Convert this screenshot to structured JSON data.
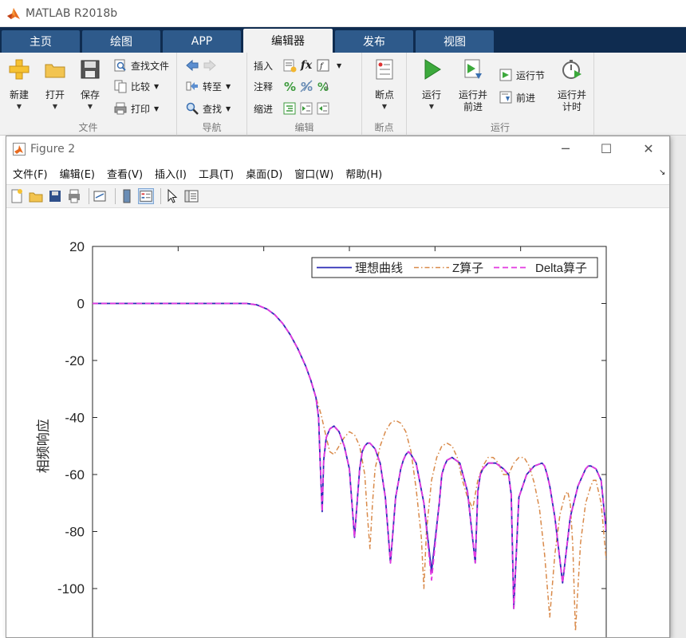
{
  "app": {
    "title": "MATLAB R2018b"
  },
  "tabs": [
    {
      "label": "主页",
      "active": false
    },
    {
      "label": "绘图",
      "active": false
    },
    {
      "label": "APP",
      "active": false
    },
    {
      "label": "编辑器",
      "active": true
    },
    {
      "label": "发布",
      "active": false
    },
    {
      "label": "视图",
      "active": false
    }
  ],
  "ribbon": {
    "file": {
      "title": "文件",
      "new_label": "新建",
      "open_label": "打开",
      "save_label": "保存",
      "find_files_label": "查找文件",
      "compare_label": "比较",
      "print_label": "打印"
    },
    "navigate": {
      "title": "导航",
      "goto_label": "转至",
      "find_label": "查找"
    },
    "edit": {
      "title": "编辑",
      "insert_label": "插入",
      "comment_label": "注释",
      "indent_label": "缩进",
      "fx_label": "fx"
    },
    "breakpoints": {
      "title": "断点",
      "breakpoints_label": "断点"
    },
    "run": {
      "title": "运行",
      "run_label": "运行",
      "run_advance_label_1": "运行并",
      "run_advance_label_2": "前进",
      "run_section_label": "运行节",
      "advance_label": "前进",
      "run_time_label_1": "运行并",
      "run_time_label_2": "计时"
    }
  },
  "figure": {
    "title": "Figure 2",
    "menu": [
      "文件(F)",
      "编辑(E)",
      "查看(V)",
      "插入(I)",
      "工具(T)",
      "桌面(D)",
      "窗口(W)",
      "帮助(H)"
    ],
    "minimize": "─",
    "maximize": "☐",
    "close": "✕"
  },
  "colors": {
    "tab_strip": "#0f2c50",
    "tab": "#2e5a8b",
    "ideal": "#2a2ab5",
    "z": "#d98a4a",
    "delta": "#e23ae0"
  },
  "chart_data": {
    "type": "line",
    "title": "",
    "xlabel": "",
    "ylabel": "相频响应",
    "ylim": [
      -110,
      20
    ],
    "yticks": [
      "20",
      "0",
      "-20",
      "-40",
      "-60",
      "-80",
      "-100"
    ],
    "xticks": [
      "",
      "",
      "",
      "",
      "",
      "",
      ""
    ],
    "grid": false,
    "legend_position": "top-right",
    "series": [
      {
        "name": "理想曲线",
        "style": "solid",
        "x": [
          0,
          0.5,
          1,
          1.5,
          2,
          2.2,
          2.4,
          2.6,
          2.8,
          3.0,
          3.2,
          3.4,
          3.55,
          3.7,
          3.85,
          4.0,
          4.15,
          4.25,
          4.35,
          4.4,
          4.43,
          4.47,
          4.5,
          4.55,
          4.62,
          4.7,
          4.8,
          4.9,
          5.0,
          5.1,
          5.2,
          5.25,
          5.3,
          5.35,
          5.4,
          5.5,
          5.6,
          5.7,
          5.8,
          5.9,
          6.0,
          6.05,
          6.1,
          6.15,
          6.2,
          6.3,
          6.45,
          6.6,
          6.75,
          6.8,
          6.85,
          6.9,
          7.0,
          7.15,
          7.3,
          7.45,
          7.5,
          7.55,
          7.6,
          7.7,
          7.85,
          8.0,
          8.1,
          8.15,
          8.2,
          8.3,
          8.45,
          8.6,
          8.75,
          8.8,
          8.85,
          8.9,
          9.0,
          9.15,
          9.3,
          9.45,
          9.55,
          9.6,
          9.65,
          9.7,
          9.8,
          9.9,
          10.0
        ],
        "y": [
          0,
          0,
          0,
          0,
          0,
          0,
          0,
          0,
          0,
          0,
          -0.5,
          -2,
          -4,
          -7,
          -11,
          -16,
          -22,
          -27,
          -33,
          -40,
          -55,
          -73,
          -55,
          -47,
          -44,
          -43,
          -45,
          -50,
          -58,
          -82,
          -58,
          -52,
          -50,
          -49,
          -49,
          -51,
          -56,
          -68,
          -91,
          -68,
          -58,
          -55,
          -53,
          -52,
          -53,
          -56,
          -70,
          -94,
          -70,
          -60,
          -57,
          -55,
          -54,
          -56,
          -66,
          -91,
          -66,
          -60,
          -58,
          -56,
          -56,
          -58,
          -60,
          -67,
          -107,
          -68,
          -60,
          -57,
          -56,
          -57,
          -60,
          -64,
          -75,
          -98,
          -75,
          -64,
          -60,
          -58,
          -57,
          -57,
          -58,
          -62,
          -80
        ]
      },
      {
        "name": "Z算子",
        "style": "dashdot",
        "x": [
          0,
          0.5,
          1,
          1.5,
          2,
          2.2,
          2.4,
          2.6,
          2.8,
          3.0,
          3.2,
          3.4,
          3.55,
          3.7,
          3.85,
          4.0,
          4.15,
          4.25,
          4.35,
          4.45,
          4.55,
          4.62,
          4.7,
          4.8,
          4.9,
          5.0,
          5.1,
          5.2,
          5.3,
          5.35,
          5.4,
          5.45,
          5.5,
          5.6,
          5.7,
          5.8,
          5.9,
          6.0,
          6.1,
          6.2,
          6.3,
          6.4,
          6.45,
          6.5,
          6.6,
          6.7,
          6.8,
          6.9,
          7.0,
          7.1,
          7.2,
          7.3,
          7.4,
          7.5,
          7.6,
          7.7,
          7.8,
          7.9,
          8.0,
          8.1,
          8.2,
          8.3,
          8.4,
          8.5,
          8.6,
          8.7,
          8.8,
          8.9,
          9.0,
          9.1,
          9.2,
          9.25,
          9.3,
          9.35,
          9.4,
          9.5,
          9.6,
          9.7,
          9.75,
          9.8,
          9.9,
          10.0
        ],
        "y": [
          0,
          0,
          0,
          0,
          0,
          0,
          0,
          0,
          0,
          0,
          -0.5,
          -2,
          -4,
          -7,
          -11,
          -16,
          -22,
          -27,
          -33,
          -39,
          -47,
          -52,
          -53,
          -50,
          -47,
          -45,
          -46,
          -50,
          -60,
          -74,
          -86,
          -70,
          -58,
          -50,
          -45,
          -42,
          -41,
          -42,
          -45,
          -52,
          -65,
          -82,
          -100,
          -80,
          -62,
          -54,
          -50,
          -49,
          -50,
          -54,
          -62,
          -68,
          -72,
          -62,
          -57,
          -54,
          -54,
          -56,
          -60,
          -60,
          -56,
          -54,
          -54,
          -57,
          -63,
          -72,
          -88,
          -110,
          -88,
          -74,
          -67,
          -66,
          -70,
          -85,
          -115,
          -84,
          -70,
          -64,
          -62,
          -62,
          -70,
          -90
        ]
      },
      {
        "name": "Delta算子",
        "style": "dashed",
        "x": [
          0,
          0.5,
          1,
          1.5,
          2,
          2.2,
          2.4,
          2.6,
          2.8,
          3.0,
          3.2,
          3.4,
          3.55,
          3.7,
          3.85,
          4.0,
          4.15,
          4.25,
          4.35,
          4.4,
          4.43,
          4.47,
          4.5,
          4.55,
          4.62,
          4.7,
          4.8,
          4.9,
          5.0,
          5.1,
          5.2,
          5.25,
          5.3,
          5.35,
          5.4,
          5.5,
          5.6,
          5.7,
          5.8,
          5.9,
          6.0,
          6.05,
          6.1,
          6.15,
          6.2,
          6.3,
          6.45,
          6.6,
          6.75,
          6.8,
          6.85,
          6.9,
          7.0,
          7.15,
          7.3,
          7.45,
          7.5,
          7.55,
          7.6,
          7.7,
          7.85,
          8.0,
          8.1,
          8.15,
          8.2,
          8.3,
          8.45,
          8.6,
          8.75,
          8.8,
          8.85,
          8.9,
          9.0,
          9.15,
          9.3,
          9.45,
          9.55,
          9.6,
          9.65,
          9.7,
          9.8,
          9.9,
          10.0
        ],
        "y": [
          0,
          0,
          0,
          0,
          0,
          0,
          0,
          0,
          0,
          0,
          -0.5,
          -2,
          -4,
          -7,
          -11,
          -16,
          -22,
          -27,
          -33,
          -40,
          -55,
          -73,
          -55,
          -47,
          -44,
          -43,
          -45,
          -50,
          -58,
          -82,
          -58,
          -52,
          -50,
          -49,
          -49,
          -51,
          -56,
          -68,
          -91,
          -68,
          -58,
          -55,
          -53,
          -52,
          -53,
          -56,
          -70,
          -97,
          -70,
          -60,
          -57,
          -55,
          -54,
          -56,
          -66,
          -91,
          -66,
          -60,
          -58,
          -56,
          -56,
          -58,
          -60,
          -67,
          -107,
          -68,
          -60,
          -57,
          -56,
          -57,
          -60,
          -64,
          -75,
          -98,
          -75,
          -64,
          -60,
          -58,
          -57,
          -57,
          -58,
          -62,
          -80
        ]
      }
    ]
  }
}
